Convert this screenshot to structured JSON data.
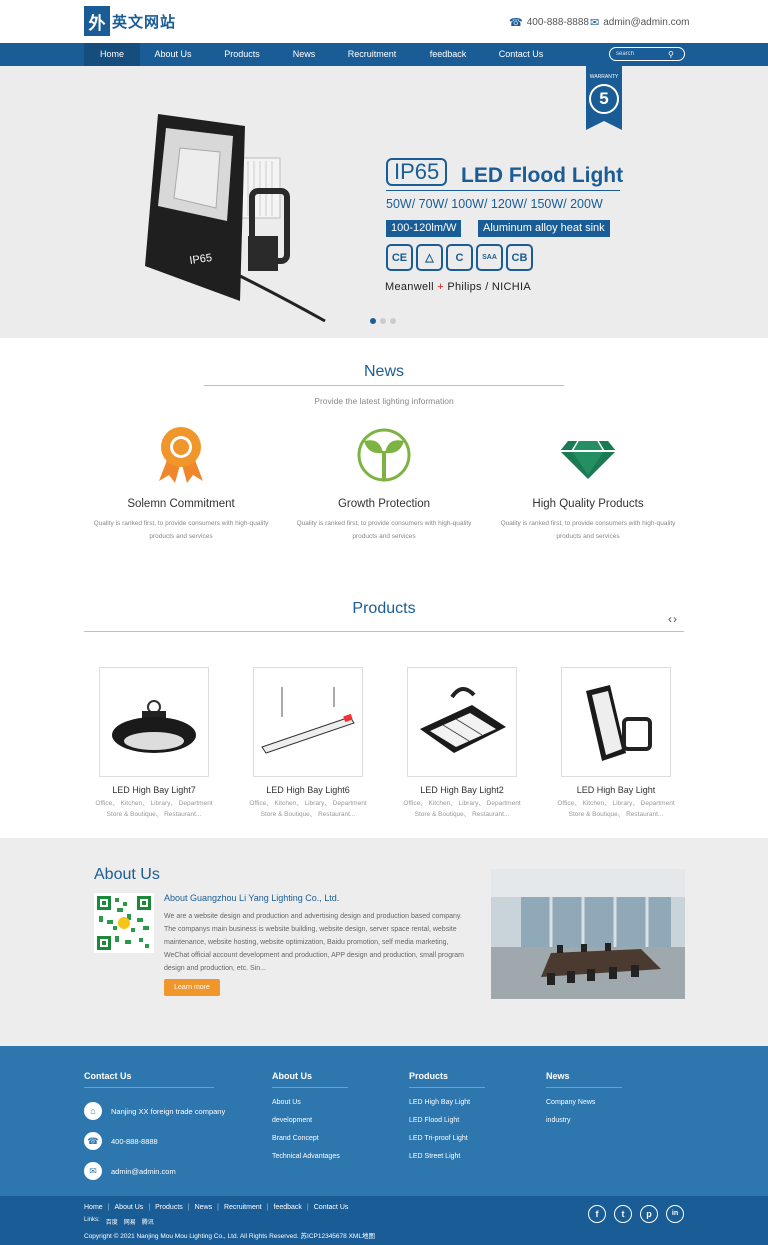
{
  "brand": {
    "logo_mark": "外",
    "logo_text": "英文网站"
  },
  "header": {
    "phone": "400-888-8888",
    "email": "admin@admin.com"
  },
  "nav": {
    "items": [
      "Home",
      "About Us",
      "Products",
      "News",
      "Recruitment",
      "feedback",
      "Contact Us"
    ],
    "search_placeholder": "search"
  },
  "banner": {
    "warranty_number": "5",
    "warranty_text": "WARRANTY",
    "ip_label": "IP65",
    "product_title": "LED Flood Light",
    "watts": "50W/ 70W/ 100W/ 120W/ 150W/ 200W",
    "badges": [
      "100-120lm/W",
      "Aluminum alloy heat sink"
    ],
    "certs": [
      "CE",
      "△",
      "C",
      "SAA",
      "CB"
    ],
    "brands_a": "Meanwell",
    "brands_plus": "+",
    "brands_b": "Philips / NICHIA",
    "device_label": "IP65",
    "slide_active": 1
  },
  "news": {
    "title": "News",
    "subtitle": "Provide the latest lighting information",
    "features": [
      {
        "title": "Solemn Commitment",
        "desc": "Quality is ranked first, to provide consumers with high-quality products and services"
      },
      {
        "title": "Growth Protection",
        "desc": "Quality is ranked first, to provide consumers with high-quality products and services"
      },
      {
        "title": "High Quality Products",
        "desc": "Quality is ranked first, to provide consumers with high-quality products and services"
      }
    ]
  },
  "products": {
    "title": "Products",
    "arrows": "‹›",
    "items": [
      {
        "name": "LED High Bay Light7",
        "desc": "Office、 Kitchen、 Library、 Department Store & Boutique、 Restaurant..."
      },
      {
        "name": "LED High Bay Light6",
        "desc": "Office、 Kitchen、 Library、 Department Store & Boutique、 Restaurant..."
      },
      {
        "name": "LED High Bay Light2",
        "desc": "Office、 Kitchen、 Library、 Department Store & Boutique、 Restaurant..."
      },
      {
        "name": "LED High Bay Light",
        "desc": "Office、 Kitchen、 Library、 Department Store & Boutique、 Restaurant..."
      }
    ]
  },
  "about": {
    "title": "About Us",
    "subtitle": "About Guangzhou Li Yang Lighting Co., Ltd.",
    "text": "We are a website design and production and advertising design and production based company. The companys main business is website building, website design, server space rental, website maintenance, website hosting, website optimization, Baidu promotion, self media marketing, WeChat official account development and production, APP design and production, small program design and production, etc. Sin...",
    "button": "Learn more"
  },
  "footer": {
    "contact": {
      "title": "Contact Us",
      "address": "Nanjing XX foreign trade company",
      "phone": "400-888-8888",
      "email": "admin@admin.com"
    },
    "about": {
      "title": "About Us",
      "links": [
        "About Us",
        "development",
        "Brand Concept",
        "Technical Advantages"
      ]
    },
    "products": {
      "title": "Products",
      "links": [
        "LED High Bay Light",
        "LED Flood Light",
        "LED Tri-proof Light",
        "LED Street Light"
      ]
    },
    "news": {
      "title": "News",
      "links": [
        "Company News",
        "industry"
      ]
    }
  },
  "bottom": {
    "nav": [
      "Home",
      "About Us",
      "Products",
      "News",
      "Recruitment",
      "feedback",
      "Contact Us"
    ],
    "links_label": "Links:",
    "links": [
      "百度",
      "网易",
      "腾讯"
    ],
    "copyright": "Copyright © 2021 Nanjing Mou Mou Lighting Co., Ltd. All Rights Reserved. 苏ICP12345678 XML地图",
    "social": [
      "f",
      "t",
      "p",
      "in"
    ]
  },
  "colors": {
    "primary": "#1a5d96",
    "footer": "#2e76ae",
    "accent": "#f0962a",
    "green": "#7cb342",
    "diamond": "#1a7a52"
  }
}
